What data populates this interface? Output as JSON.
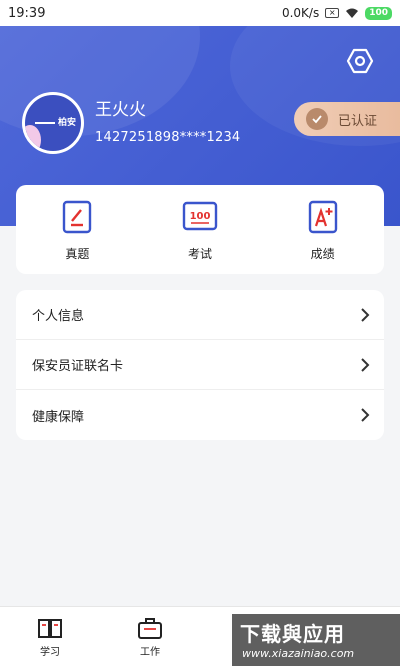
{
  "status_bar": {
    "time": "19:39",
    "network_speed": "0.0K/s",
    "battery": "100"
  },
  "profile": {
    "name": "王火火",
    "phone": "1427251898****1234",
    "avatar_text": "柏安",
    "verify_label": "已认证"
  },
  "quick_actions": [
    {
      "label": "真题",
      "icon": "exam-paper-icon"
    },
    {
      "label": "考试",
      "icon": "score-100-icon"
    },
    {
      "label": "成绩",
      "icon": "grade-a-plus-icon"
    }
  ],
  "menu": [
    {
      "label": "个人信息"
    },
    {
      "label": "保安员证联名卡"
    },
    {
      "label": "健康保障"
    }
  ],
  "tabs": [
    {
      "label": "学习",
      "icon": "book-icon"
    },
    {
      "label": "工作",
      "icon": "briefcase-icon"
    }
  ],
  "watermark": {
    "title": "下载與应用",
    "url": "www.xiazainiao.com"
  },
  "colors": {
    "header": "#4f68d9",
    "accent": "#3a55cc",
    "icon_red": "#e3322f",
    "badge": "#e8b99b"
  }
}
